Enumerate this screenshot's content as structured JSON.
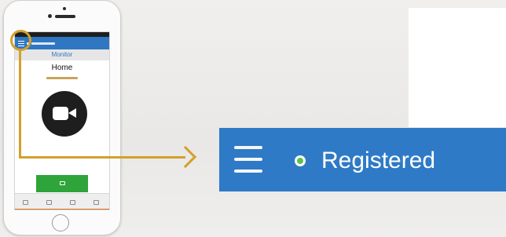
{
  "app": {
    "monitor_title": "Monitor",
    "home_label": "Home"
  },
  "banner": {
    "status_text": "Registered",
    "status_color": "#5bc24b",
    "bar_color": "#2f7ac6",
    "menu_icon": "hamburger-menu-icon"
  },
  "highlight": {
    "color": "#d4a02b"
  }
}
